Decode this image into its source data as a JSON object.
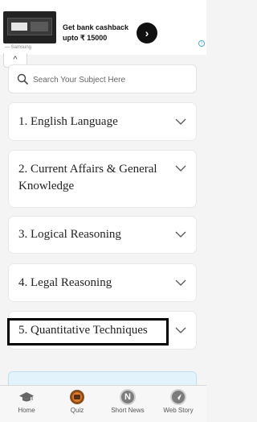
{
  "ad": {
    "headline": "Get bank cashback upto ₹ 15000",
    "cta_glyph": "›",
    "brand": "— Samsung",
    "info_glyph": "i"
  },
  "collapse_glyph": "^",
  "search": {
    "placeholder": "Search Your Subject Here"
  },
  "subjects": [
    {
      "label": "1. English Language"
    },
    {
      "label": "2. Current Affairs & General Knowledge"
    },
    {
      "label": "3. Logical Reasoning"
    },
    {
      "label": "4. Legal Reasoning"
    },
    {
      "label": "5. Quantitative Techniques"
    }
  ],
  "nav": {
    "items": [
      {
        "label": "Home",
        "icon": "graduation-cap-icon"
      },
      {
        "label": "Quiz",
        "icon": "quiz-icon"
      },
      {
        "label": "Short News",
        "icon": "news-icon",
        "glyph": "N"
      },
      {
        "label": "Web Story",
        "icon": "web-story-icon"
      }
    ]
  },
  "colors": {
    "background": "#f4f4f4",
    "card": "#ffffff",
    "highlight_border": "#000000",
    "info_box": "#e3f3fb"
  }
}
